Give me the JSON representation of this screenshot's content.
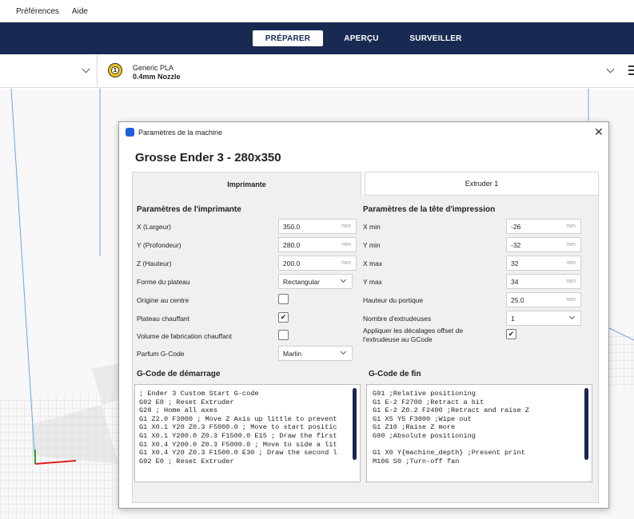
{
  "menubar": {
    "items": [
      "Préférences",
      "Aide"
    ]
  },
  "topnav": {
    "tabs": [
      "PRÉPARER",
      "APERÇU",
      "SURVEILLER"
    ]
  },
  "material": {
    "index": "1",
    "name": "Generic PLA",
    "nozzle": "0.4mm Nozzle"
  },
  "dialog": {
    "title": "Paramètres de la machine",
    "heading": "Grosse Ender 3 - 280x350",
    "tabs": [
      "Imprimante",
      "Extruder 1"
    ],
    "printer_section": {
      "title": "Paramètres de l'imprimante",
      "x_label": "X (Largeur)",
      "x_value": "350.0",
      "x_unit": "mm",
      "y_label": "Y (Profondeur)",
      "y_value": "280.0",
      "y_unit": "mm",
      "z_label": "Z (Hauteur)",
      "z_value": "200.0",
      "z_unit": "mm",
      "shape_label": "Forme du plateau",
      "shape_value": "Rectangular",
      "origin_label": "Origine au centre",
      "origin_checked": "",
      "heated_bed_label": "Plateau chauffant",
      "heated_bed_checked": "✔",
      "heated_volume_label": "Volume de fabrication chauffant",
      "heated_volume_checked": "",
      "gcode_flavor_label": "Parfum G-Code",
      "gcode_flavor_value": "Marlin"
    },
    "head_section": {
      "title": "Paramètres de la tête d'impression",
      "xmin_label": "X min",
      "xmin_value": "-26",
      "xmin_unit": "mm",
      "ymin_label": "Y min",
      "ymin_value": "-32",
      "ymin_unit": "mm",
      "xmax_label": "X max",
      "xmax_value": "32",
      "xmax_unit": "mm",
      "ymax_label": "Y max",
      "ymax_value": "34",
      "ymax_unit": "mm",
      "gantry_label": "Hauteur du portique",
      "gantry_value": "25.0",
      "gantry_unit": "mm",
      "extruders_label": "Nombre d'extrudeuses",
      "extruders_value": "1",
      "apply_offsets_label_1": "Appliquer les décalages offset de",
      "apply_offsets_label_2": "l'extrudeuse au GCode",
      "apply_offsets_checked": "✔"
    },
    "start_gcode": {
      "title": "G-Code de démarrage",
      "lines": [
        "; Ender 3 Custom Start G-code",
        "G92 E0 ; Reset Extruder",
        "G28 ; Home all axes",
        "G1 Z2.0 F3000 ; Move Z Axis up little to prevent",
        "G1 X0.1 Y20 Z0.3 F5000.0 ; Move to start positic",
        "G1 X0.1 Y200.0 Z0.3 F1500.0 E15 ; Draw the first",
        "G1 X0.4 Y200.0 Z0.3 F5000.0 ; Move to side a lit",
        "G1 X0.4 Y20 Z0.3 F1500.0 E30 ; Draw the second l",
        "G92 E0 ; Reset Extruder"
      ]
    },
    "end_gcode": {
      "title": "G-Code de fin",
      "lines": [
        "G91 ;Relative positioning",
        "G1 E-2 F2700 ;Retract a bit",
        "G1 E-2 Z0.2 F2400 ;Retract and raise Z",
        "G1 X5 Y5 F3000 ;Wipe out",
        "G1 Z10 ;Raise Z more",
        "G90 ;Absolute positioning",
        "",
        "G1 X0 Y{machine_depth} ;Present print",
        "M106 S0 ;Turn-off fan"
      ]
    }
  },
  "colors": {
    "nav_bg": "#192a52",
    "accent": "#1f5fe0",
    "scrollbar": "#1a2550"
  }
}
